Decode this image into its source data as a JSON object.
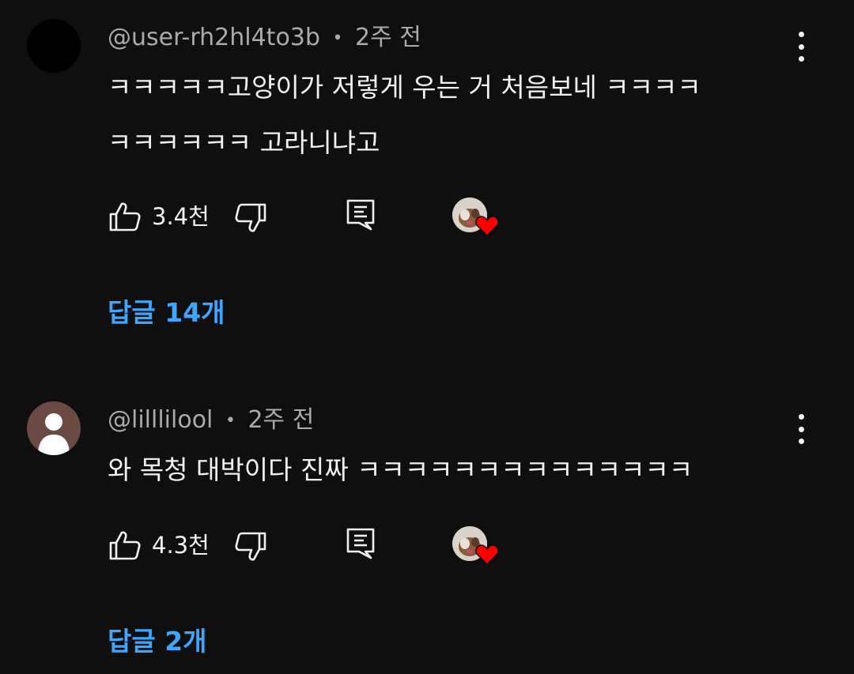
{
  "colors": {
    "background": "#0f0f0f",
    "text": "#f1f1f1",
    "secondary_text": "#aaaaaa",
    "link": "#3ea6ff",
    "heart": "#ff0000"
  },
  "comments": [
    {
      "author": "@user-rh2hl4to3b",
      "separator": "•",
      "time": "2주 전",
      "text_line1": "ㅋㅋㅋㅋㅋ고양이가 저렇게 우는 거 처음보네 ㅋㅋㅋㅋ",
      "text_line2": "ㅋㅋㅋㅋㅋㅋ 고라니냐고",
      "likes": "3.4천",
      "replies": "답글 14개",
      "icons": [
        "more-vert-icon",
        "thumb-up-icon",
        "thumb-down-icon",
        "reply-icon",
        "creator-heart-icon"
      ]
    },
    {
      "author": "@lilllilool",
      "separator": "•",
      "time": "2주 전",
      "text_line1": "와 목청 대박이다 진짜 ㅋㅋㅋㅋㅋㅋㅋㅋㅋㅋㅋㅋㅋㅋ",
      "likes": "4.3천",
      "replies": "답글 2개",
      "icons": [
        "default-avatar-icon",
        "more-vert-icon",
        "thumb-up-icon",
        "thumb-down-icon",
        "reply-icon",
        "creator-heart-icon"
      ]
    }
  ]
}
